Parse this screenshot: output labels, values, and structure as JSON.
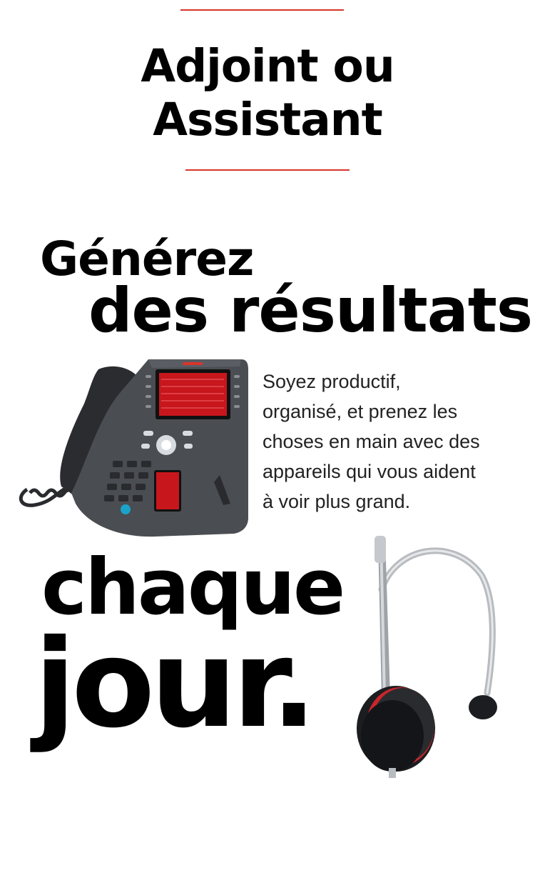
{
  "heading": {
    "line1": "Adjoint ou",
    "line2": "Assistant"
  },
  "hero": {
    "word1": "Générez",
    "word2": "des résultats",
    "word3": "chaque",
    "word4": "jour."
  },
  "description": {
    "line1": "Soyez productif,",
    "line2": "organisé, et prenez les",
    "line3": "choses en main avec des",
    "line4": "appareils qui vous aident",
    "line5": "à voir plus grand."
  },
  "colors": {
    "accent": "#d8342c",
    "text": "#000000",
    "body_text": "#222222",
    "device_gray": "#4a4d52",
    "screen_red": "#c8161d"
  },
  "images": {
    "phone": "desk-phone-image",
    "headset": "headset-image"
  }
}
